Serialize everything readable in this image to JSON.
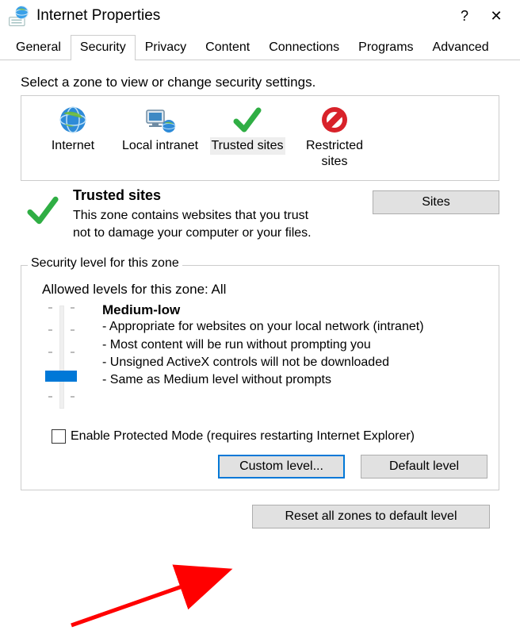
{
  "window": {
    "title": "Internet Properties",
    "help_symbol": "?",
    "close_symbol": "✕"
  },
  "tabs": {
    "general": "General",
    "security": "Security",
    "privacy": "Privacy",
    "content": "Content",
    "connections": "Connections",
    "programs": "Programs",
    "advanced": "Advanced"
  },
  "zone_select_label": "Select a zone to view or change security settings.",
  "zones": {
    "internet": "Internet",
    "local_intranet": "Local intranet",
    "trusted_sites": "Trusted sites",
    "restricted_sites": "Restricted sites"
  },
  "zone_detail": {
    "title": "Trusted sites",
    "description": "This zone contains websites that you trust not to damage your computer or your files.",
    "sites_button": "Sites"
  },
  "security_group": {
    "label": "Security level for this zone",
    "allowed": "Allowed levels for this zone: All",
    "level_name": "Medium-low",
    "bullet1": "- Appropriate for websites on your local network (intranet)",
    "bullet2": "- Most content will be run without prompting you",
    "bullet3": "- Unsigned ActiveX controls will not be downloaded",
    "bullet4": "- Same as Medium level without prompts",
    "protected_mode": "Enable Protected Mode (requires restarting Internet Explorer)",
    "custom_level": "Custom level...",
    "default_level": "Default level"
  },
  "reset_button": "Reset all zones to default level"
}
